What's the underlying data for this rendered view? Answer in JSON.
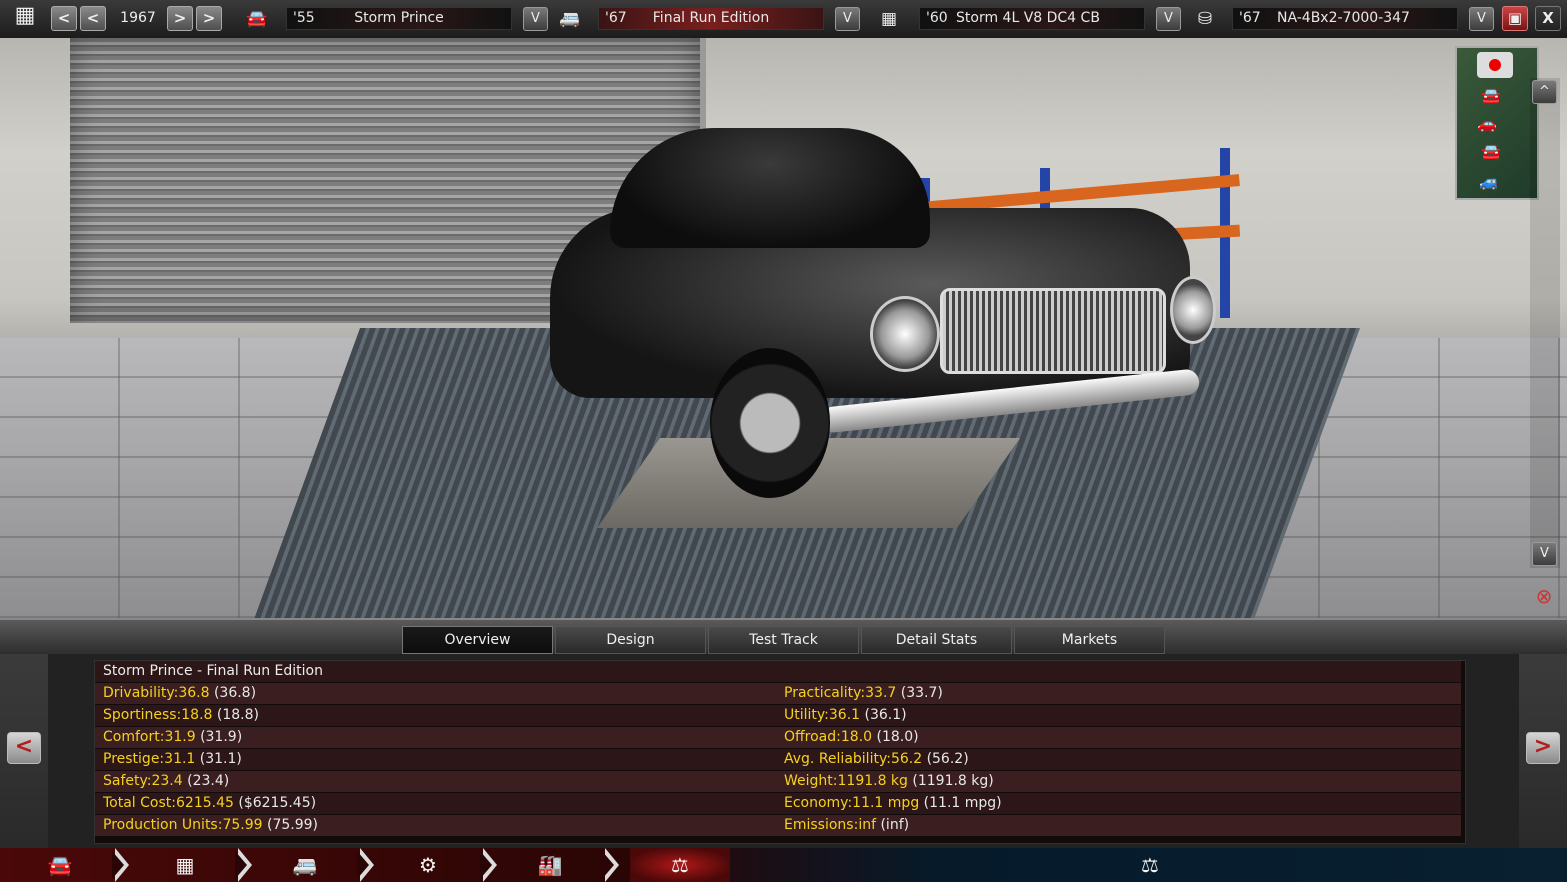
{
  "topbar": {
    "year": "1967",
    "model": {
      "year": "'55",
      "name": "Storm Prince"
    },
    "trim": {
      "year": "'67",
      "name": "Final Run Edition"
    },
    "engine": {
      "year": "'60",
      "name": "Storm 4L V8 DC4 CB"
    },
    "engine_variant": {
      "year": "'67",
      "name": "NA-4Bx2-7000-347"
    },
    "prev_label": "<",
    "next_label": ">",
    "dropdown_label": "V",
    "close_label": "X"
  },
  "viewport": {
    "scroll_up": "^",
    "scroll_down": "V"
  },
  "tabs": [
    {
      "label": "Overview",
      "active": true
    },
    {
      "label": "Design",
      "active": false
    },
    {
      "label": "Test Track",
      "active": false
    },
    {
      "label": "Detail Stats",
      "active": false
    },
    {
      "label": "Markets",
      "active": false
    }
  ],
  "stats": {
    "title": "Storm Prince - Final Run Edition",
    "left": [
      {
        "label": "Drivability:",
        "value": "36.8",
        "prev": "(36.8)"
      },
      {
        "label": "Sportiness:",
        "value": "18.8",
        "prev": "(18.8)"
      },
      {
        "label": "Comfort:",
        "value": "31.9",
        "prev": "(31.9)"
      },
      {
        "label": "Prestige:",
        "value": "31.1",
        "prev": "(31.1)"
      },
      {
        "label": "Safety:",
        "value": "23.4",
        "prev": "(23.4)"
      },
      {
        "label": "Total Cost:",
        "value": "6215.45",
        "prev": "($6215.45)"
      },
      {
        "label": "Production Units:",
        "value": "75.99",
        "prev": "(75.99)"
      }
    ],
    "right": [
      {
        "label": "Practicality:",
        "value": "33.7",
        "prev": "(33.7)"
      },
      {
        "label": "Utility:",
        "value": "36.1",
        "prev": "(36.1)"
      },
      {
        "label": "Offroad:",
        "value": "18.0",
        "prev": "(18.0)"
      },
      {
        "label": "Avg. Reliability:",
        "value": "56.2",
        "prev": "(56.2)"
      },
      {
        "label": "Weight:",
        "value": "1191.8 kg",
        "prev": "(1191.8 kg)"
      },
      {
        "label": "Economy:",
        "value": "11.1 mpg",
        "prev": "(11.1 mpg)"
      },
      {
        "label": "Emissions:",
        "value": "inf",
        "prev": "(inf)"
      }
    ],
    "prev_arrow": "<",
    "next_arrow": ">"
  },
  "bottombar": {
    "steps": [
      {
        "icon": "car-icon",
        "glyph": "🚘"
      },
      {
        "icon": "engine-icon",
        "glyph": "▦"
      },
      {
        "icon": "van-icon",
        "glyph": "🚐"
      },
      {
        "icon": "head-gear-icon",
        "glyph": "⚙"
      },
      {
        "icon": "factory-icon",
        "glyph": "🏭"
      },
      {
        "icon": "scales-icon",
        "glyph": "⚖"
      }
    ],
    "right_icon": "⚖"
  },
  "colors": {
    "stat_yellow": "#f5d21d",
    "accent_red": "#b31d1d",
    "rack_blue": "#2444a8",
    "rack_orange": "#d8661e"
  }
}
